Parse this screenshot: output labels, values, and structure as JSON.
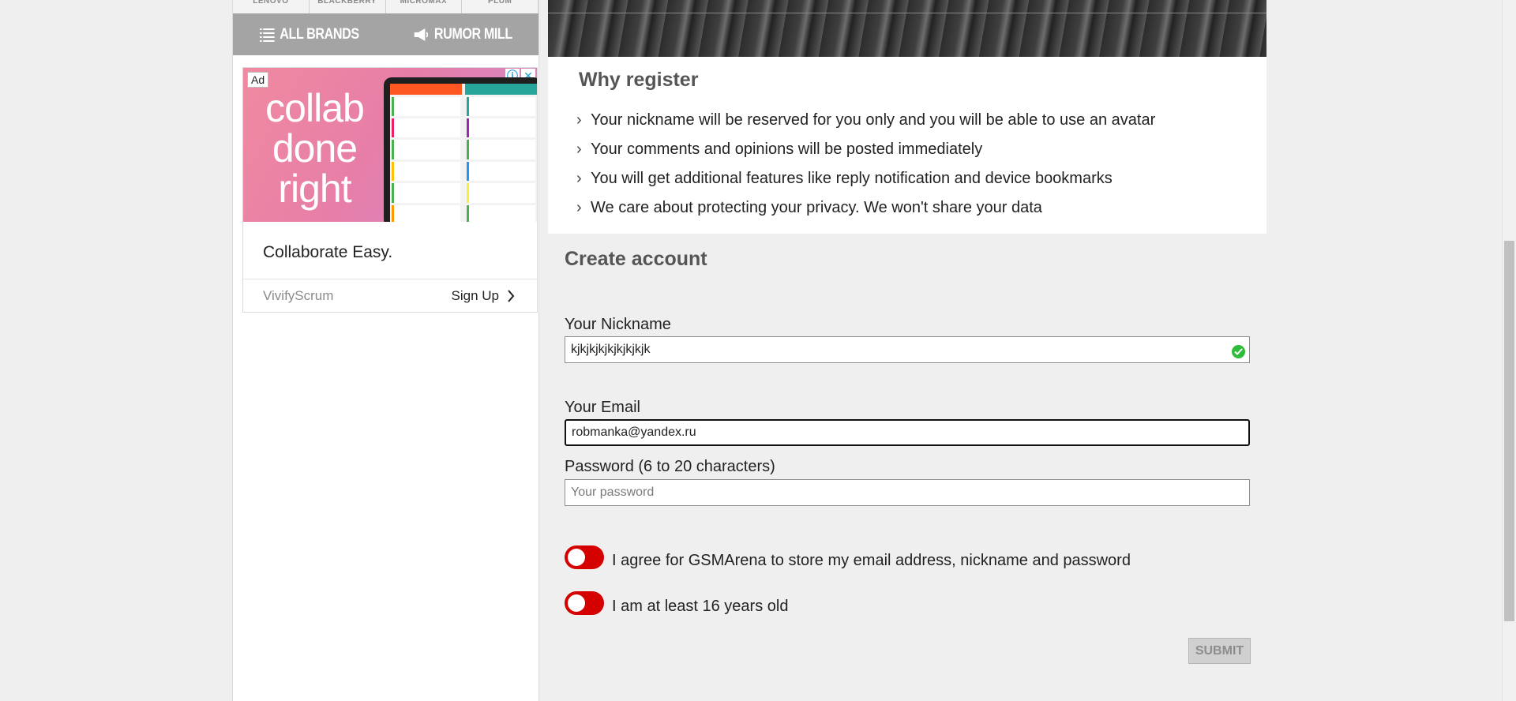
{
  "brand_strip": [
    "LENOVO",
    "BLACKBERRY",
    "MICROMAX",
    "PLUM"
  ],
  "nav": {
    "all_brands": "ALL BRANDS",
    "rumor_mill": "RUMOR MILL"
  },
  "ad": {
    "badge": "Ad",
    "headline": "collab done right",
    "title": "Collaborate Easy.",
    "sponsor": "VivifyScrum",
    "cta": "Sign Up",
    "info_icon": "info-icon",
    "close_icon": "close-icon"
  },
  "why_register": {
    "title": "Why register",
    "items": [
      "Your nickname will be reserved for you only and you will be able to use an avatar",
      "Your comments and opinions will be posted immediately",
      "You will get additional features like reply notification and device bookmarks",
      "We care about protecting your privacy. We won't share your data"
    ]
  },
  "form": {
    "title": "Create account",
    "nickname_label": "Your Nickname",
    "nickname_value": "kjkjkjkjkjkjkjkjk",
    "email_label": "Your Email",
    "email_value": "robmanka@yandex.ru",
    "password_label": "Password (6 to 20 characters)",
    "password_placeholder": "Your password",
    "agree_label": "I agree for GSMArena to store my email address, nickname and password",
    "age_label": "I am at least 16 years old",
    "submit_label": "SUBMIT"
  },
  "colors": {
    "toggle": "#d50000",
    "valid": "#2ebd3a",
    "nav_bg": "#a4a4a4"
  }
}
